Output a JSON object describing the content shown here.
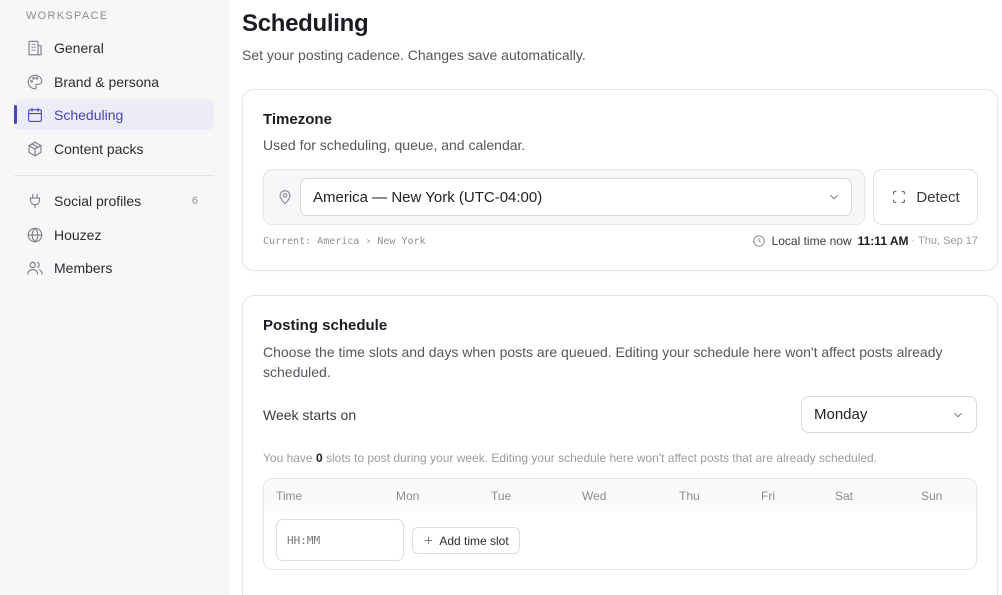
{
  "sidebar": {
    "section_label": "WORKSPACE",
    "items": [
      {
        "label": "General",
        "icon": "building-icon"
      },
      {
        "label": "Brand & persona",
        "icon": "palette-icon"
      },
      {
        "label": "Scheduling",
        "icon": "calendar-icon",
        "active": true
      },
      {
        "label": "Content packs",
        "icon": "package-icon"
      },
      {
        "label": "Social profiles",
        "icon": "plug-icon",
        "badge": "6"
      },
      {
        "label": "Houzez",
        "icon": "globe-icon"
      },
      {
        "label": "Members",
        "icon": "users-icon"
      }
    ]
  },
  "page": {
    "title": "Scheduling",
    "subtitle": "Set your posting cadence. Changes save automatically."
  },
  "timezone": {
    "title": "Timezone",
    "description": "Used for scheduling, queue, and calendar.",
    "selected": "America — New York (UTC-04:00)",
    "detect_label": "Detect",
    "current_label": "Current: America › New York",
    "local_time_label": "Local time now",
    "local_time": "11:11 AM",
    "local_date": "· Thu, Sep 17"
  },
  "posting_schedule": {
    "title": "Posting schedule",
    "description": "Choose the time slots and days when posts are queued. Editing your schedule here won't affect posts already scheduled.",
    "week_starts_label": "Week starts on",
    "week_starts_value": "Monday",
    "slots_prefix": "You have",
    "slots_count": "0",
    "slots_suffix": "slots to post during your week. Editing your schedule here won't affect posts that are already scheduled.",
    "columns": [
      "Time",
      "Mon",
      "Tue",
      "Wed",
      "Thu",
      "Fri",
      "Sat",
      "Sun"
    ],
    "time_placeholder": "HH:MM",
    "add_slot_label": "Add time slot"
  },
  "colors": {
    "accent": "#4c45c2",
    "active_bg": "#ececf7",
    "sidebar_bg": "#f7f7f8"
  }
}
